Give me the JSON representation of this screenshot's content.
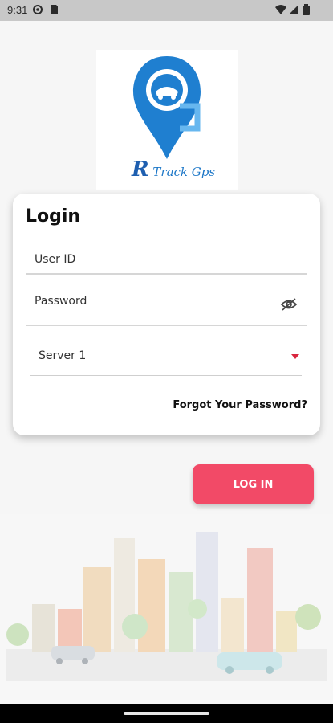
{
  "status_bar": {
    "time": "9:31"
  },
  "logo": {
    "text": "Track Gps",
    "letter": "R"
  },
  "login_card": {
    "title": "Login",
    "user_id_placeholder": "User ID",
    "password_placeholder": "Password",
    "server_selected": "Server 1",
    "forgot_password": "Forgot Your Password?"
  },
  "login_button": {
    "label": "LOG IN"
  },
  "colors": {
    "accent": "#f24a67",
    "logo_blue": "#1e78c8",
    "dropdown_arrow": "#d9263e"
  }
}
